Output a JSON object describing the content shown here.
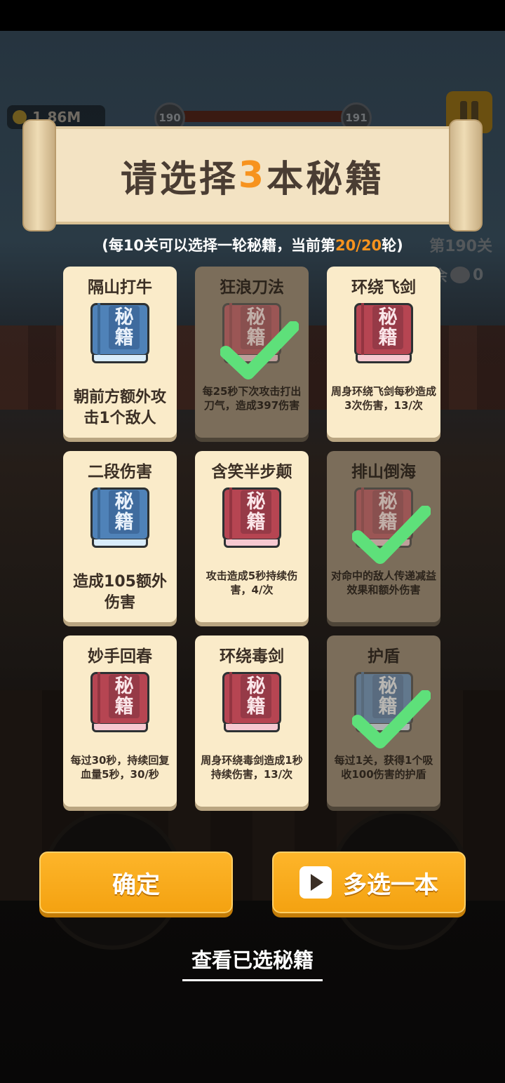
{
  "hud": {
    "coins": "1.86M",
    "level_current": "190",
    "level_next": "191",
    "level_label": "第190关",
    "remaining_label": "剩余",
    "remaining_count": "0"
  },
  "dialog": {
    "title_prefix": "请选择",
    "title_number": "3",
    "title_suffix": "本秘籍",
    "subtitle_prefix": "(每10关可以选择一轮秘籍，当前第",
    "subtitle_round": "20/20",
    "subtitle_suffix": "轮)",
    "book_label_top": "秘",
    "book_label_bottom": "籍"
  },
  "cards": [
    {
      "name": "隔山打牛",
      "desc": "朝前方额外攻击1个敌人",
      "color": "blue",
      "selected": false
    },
    {
      "name": "狂浪刀法",
      "desc": "每25秒下次攻击打出刀气，造成397伤害",
      "color": "red",
      "selected": true
    },
    {
      "name": "环绕飞剑",
      "desc": "周身环绕飞剑每秒造成3次伤害，13/次",
      "color": "red",
      "selected": false
    },
    {
      "name": "二段伤害",
      "desc": "造成105额外伤害",
      "color": "blue",
      "selected": false
    },
    {
      "name": "含笑半步颠",
      "desc": "攻击造成5秒持续伤害，4/次",
      "color": "red",
      "selected": false
    },
    {
      "name": "排山倒海",
      "desc": "对命中的敌人传递减益效果和额外伤害",
      "color": "red",
      "selected": true
    },
    {
      "name": "妙手回春",
      "desc": "每过30秒，持续回复血量5秒，30/秒",
      "color": "red",
      "selected": false
    },
    {
      "name": "环绕毒剑",
      "desc": "周身环绕毒剑造成1秒持续伤害，13/次",
      "color": "red",
      "selected": false
    },
    {
      "name": "护盾",
      "desc": "每过1关，获得1个吸收100伤害的护盾",
      "color": "blue",
      "selected": true
    }
  ],
  "buttons": {
    "confirm": "确定",
    "extra": "多选一本",
    "view_selected": "查看已选秘籍"
  },
  "colors": {
    "accent_orange": "#f7931e",
    "button_yellow": "#fdb52a",
    "check_green": "#5ee07a",
    "card_bg": "#faebc9",
    "card_selected_bg": "#7b6d5a"
  }
}
